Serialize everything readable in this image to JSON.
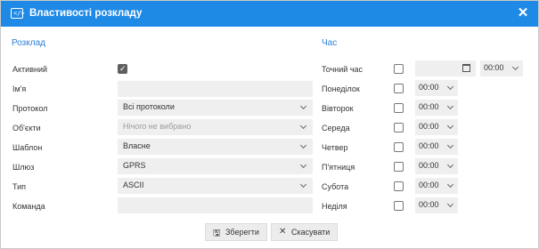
{
  "window": {
    "title": "Властивості розкладу",
    "title_icon": "</>",
    "close": "✕"
  },
  "schedule": {
    "section_title": "Розклад",
    "active_label": "Активний",
    "active_checked": true,
    "name_label": "Ім'я",
    "name_value": "",
    "protocol_label": "Протокол",
    "protocol_value": "Всі протоколи",
    "objects_label": "Об'єкти",
    "objects_placeholder": "Нічого не вибрано",
    "template_label": "Шаблон",
    "template_value": "Власне",
    "gateway_label": "Шлюз",
    "gateway_value": "GPRS",
    "type_label": "Тип",
    "type_value": "ASCII",
    "command_label": "Команда",
    "command_value": ""
  },
  "time": {
    "section_title": "Час",
    "exact_label": "Точний час",
    "exact_time": "00:00",
    "days": [
      {
        "label": "Понеділок",
        "time": "00:00"
      },
      {
        "label": "Вівторок",
        "time": "00:00"
      },
      {
        "label": "Середа",
        "time": "00:00"
      },
      {
        "label": "Четвер",
        "time": "00:00"
      },
      {
        "label": "П'ятниця",
        "time": "00:00"
      },
      {
        "label": "Субота",
        "time": "00:00"
      },
      {
        "label": "Неділя",
        "time": "00:00"
      }
    ]
  },
  "buttons": {
    "save_label": "Зберегти",
    "save_icon": "floppy-disk-icon",
    "cancel_label": "Скасувати",
    "cancel_icon": "x-icon"
  },
  "colors": {
    "titlebar": "#1f8ae6",
    "section_title": "#2a7fd4",
    "field_bg": "#efefef"
  }
}
